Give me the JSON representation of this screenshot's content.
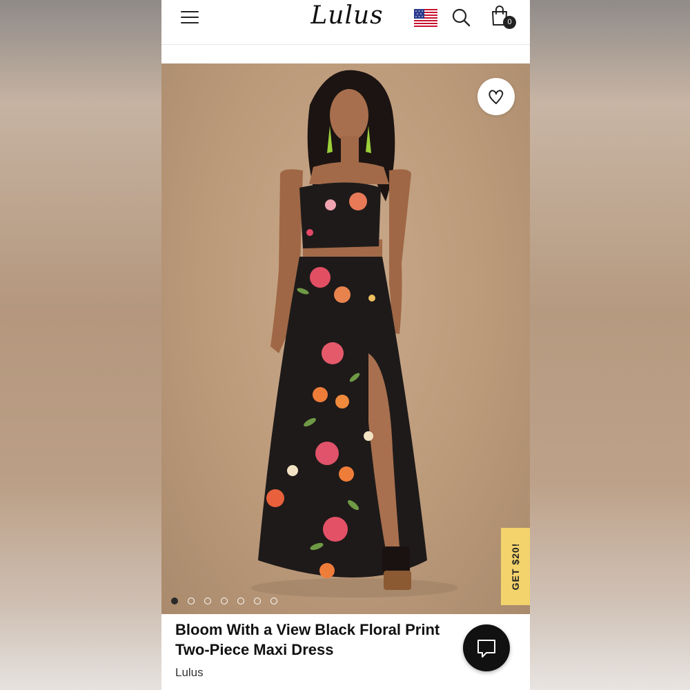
{
  "header": {
    "logo": "Lulus",
    "cart_count": "0"
  },
  "product": {
    "title_line1": "Bloom With a View Black Floral Print",
    "title_line2": "Two-Piece Maxi Dress",
    "brand": "Lulus",
    "image_count": 7,
    "active_image": 1
  },
  "promo": {
    "label": "GET $20!"
  },
  "colors": {
    "promo_tab": "#f3d36b",
    "dress": "#1e1a1a",
    "backdrop": "#bb9a7a"
  },
  "icons": [
    "menu-icon",
    "us-flag-icon",
    "search-icon",
    "shopping-bag-icon",
    "heart-icon",
    "chat-icon"
  ]
}
